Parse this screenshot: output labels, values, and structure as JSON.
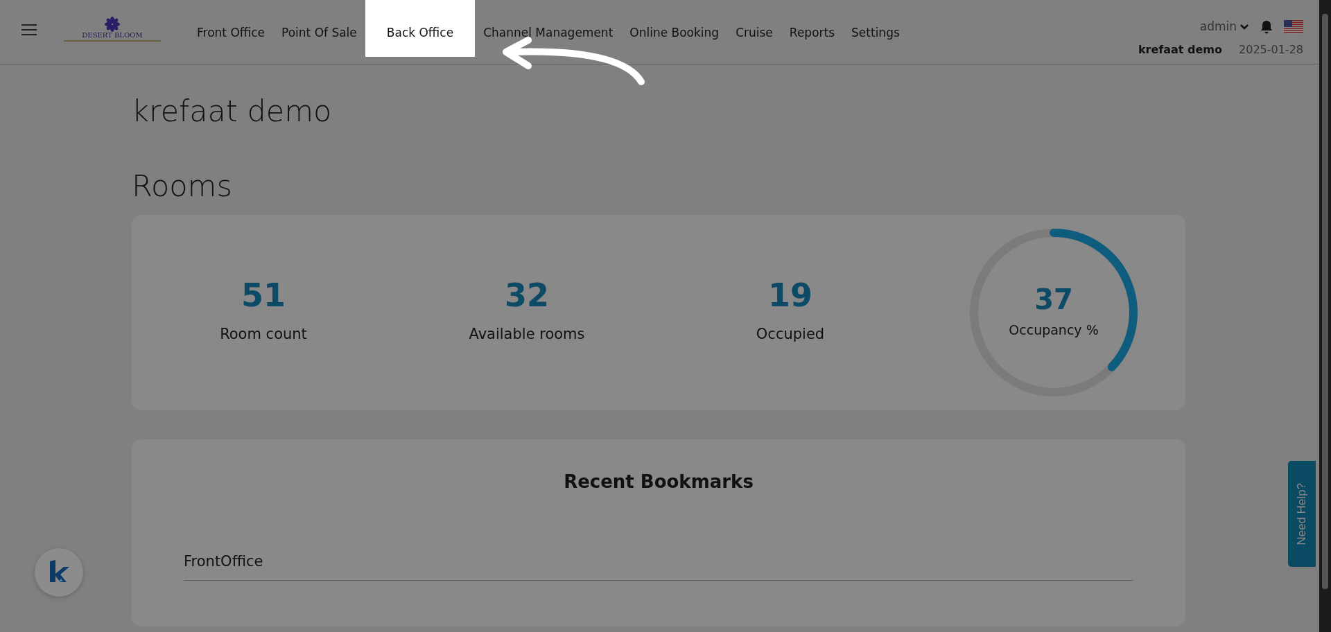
{
  "header": {
    "logo": "DESERT BLOOM",
    "nav": [
      {
        "label": "Front Office",
        "selected": false
      },
      {
        "label": "Point Of Sale",
        "selected": false
      },
      {
        "label": "Back Office",
        "selected": true
      },
      {
        "label": "Channel Management",
        "selected": false
      },
      {
        "label": "Online Booking",
        "selected": false
      },
      {
        "label": "Cruise",
        "selected": false
      },
      {
        "label": "Reports",
        "selected": false
      },
      {
        "label": "Settings",
        "selected": false
      }
    ],
    "user": "admin",
    "hotel": "krefaat demo",
    "date": "2025-01-28"
  },
  "page": {
    "title": "krefaat demo",
    "section": "Rooms"
  },
  "stats": [
    {
      "kind": "number",
      "value": "51",
      "label": "Room count"
    },
    {
      "kind": "number",
      "value": "32",
      "label": "Available rooms"
    },
    {
      "kind": "number",
      "value": "19",
      "label": "Occupied"
    },
    {
      "kind": "gauge",
      "value": "37",
      "label": "Occupancy %"
    }
  ],
  "bookmarks": {
    "title": "Recent Bookmarks",
    "items": [
      "FrontOffice"
    ]
  },
  "help_tab": "Need Help?"
}
